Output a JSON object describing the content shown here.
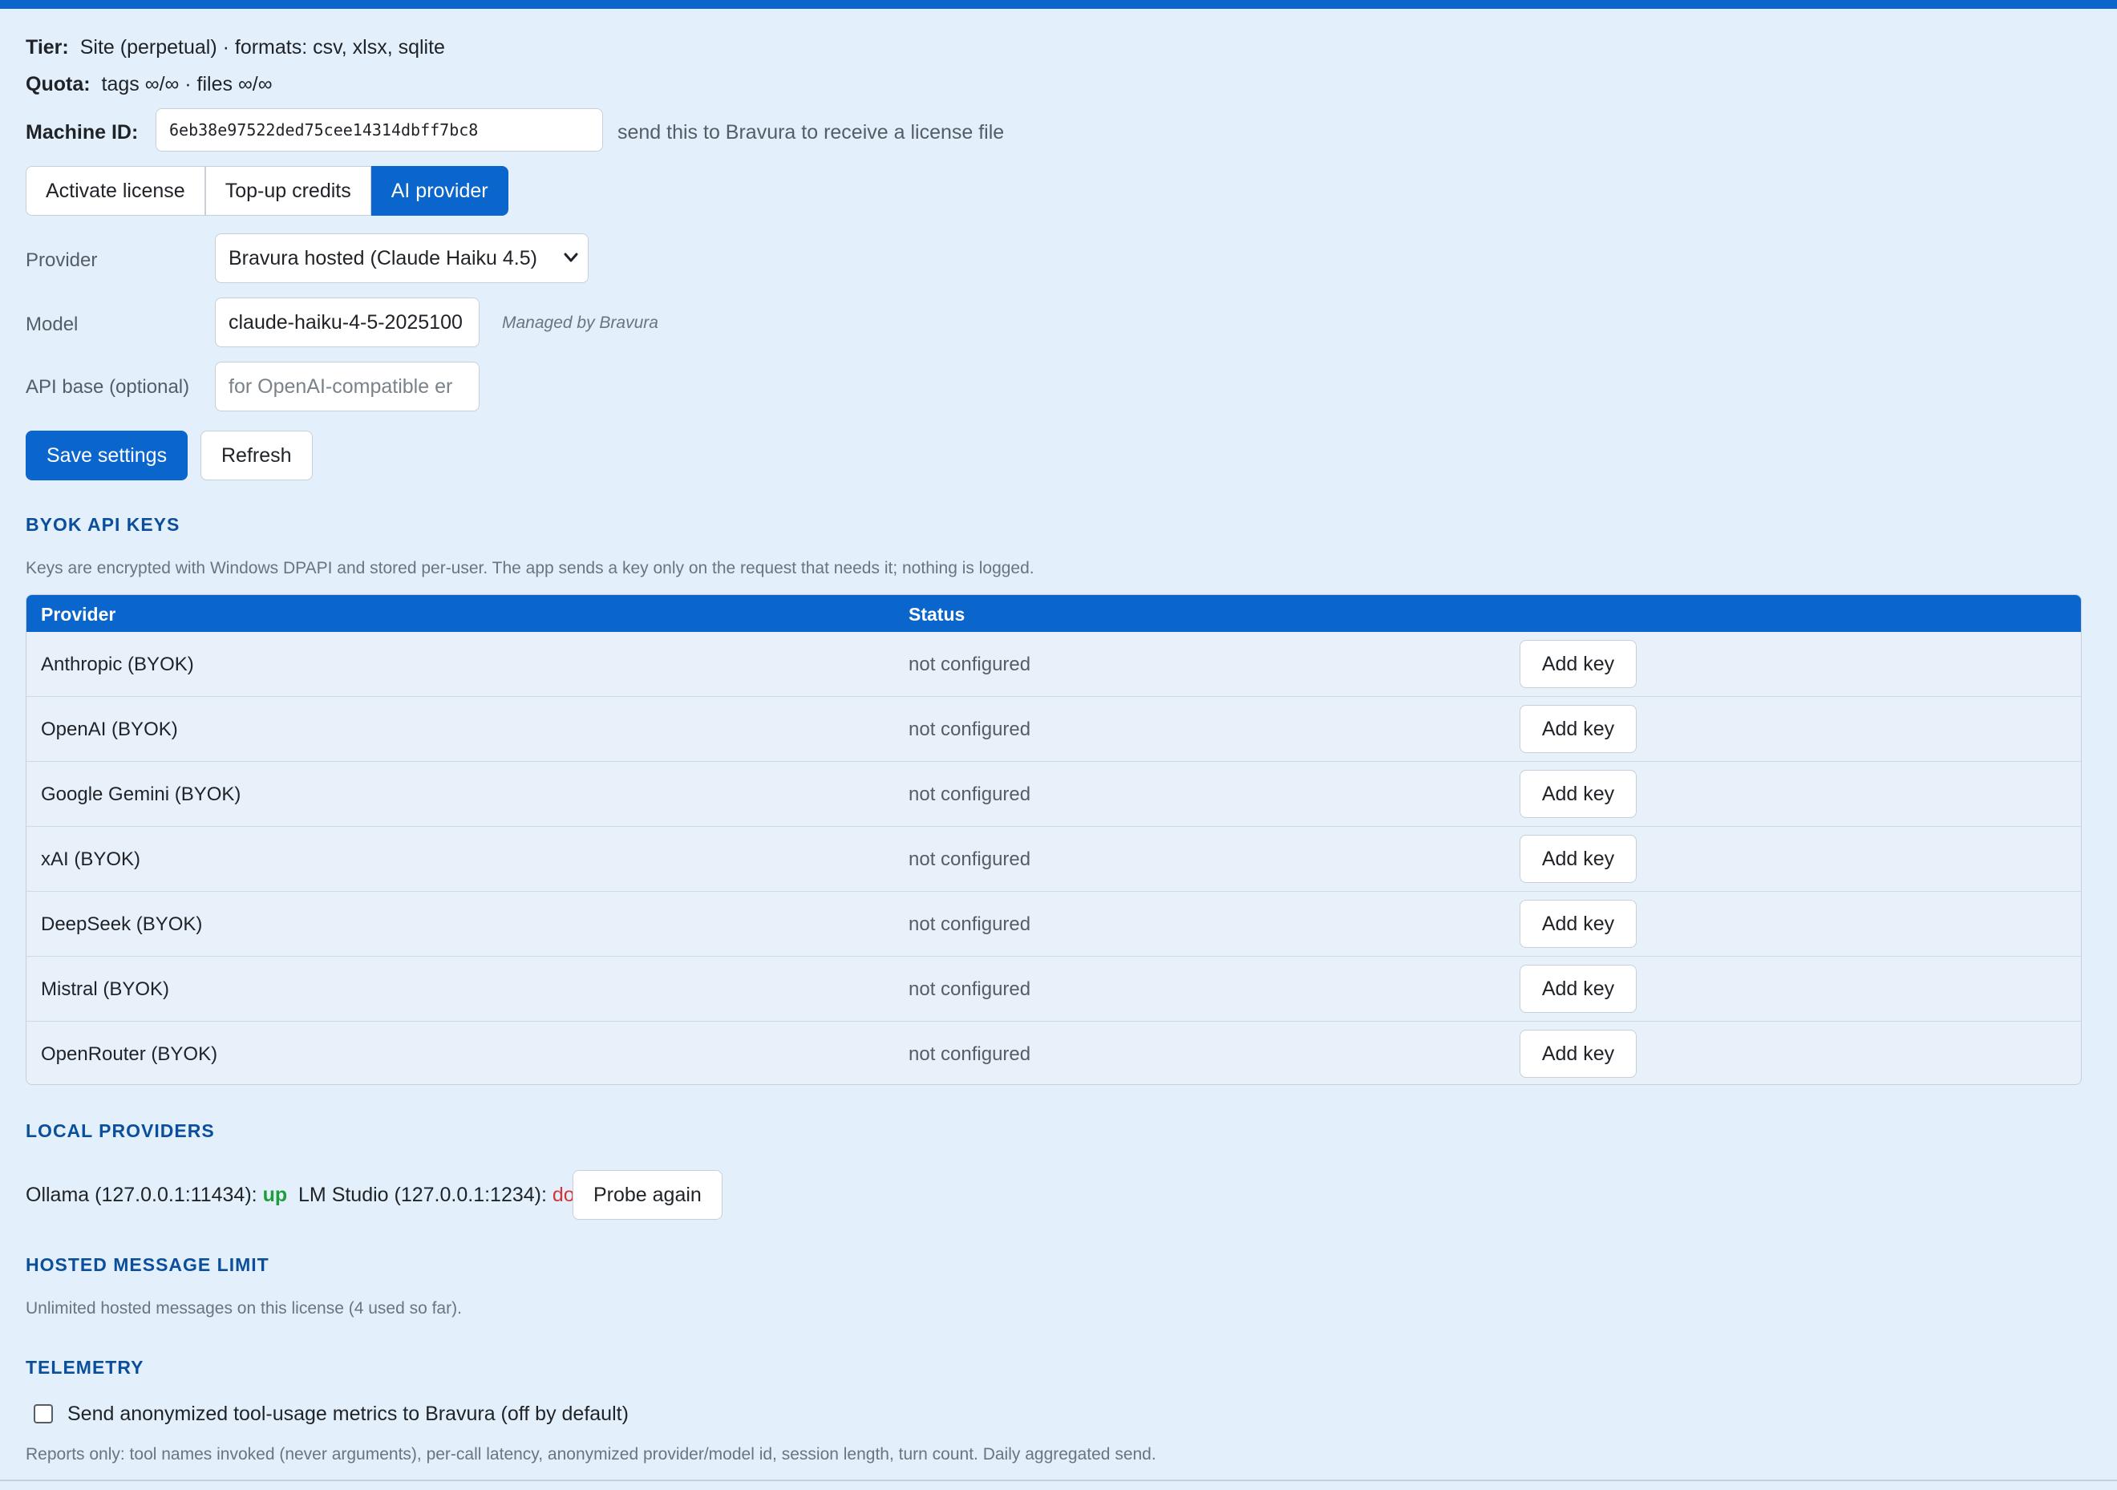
{
  "license": {
    "tier_label": "Tier:",
    "tier_value": "Site (perpetual) · formats: csv, xlsx, sqlite",
    "quota_label": "Quota:",
    "quota_value": "tags ∞/∞ · files ∞/∞",
    "machine_id_label": "Machine ID:",
    "machine_id_value": "6eb38e97522ded75cee14314dbff7bc8",
    "machine_id_hint": "send this to Bravura to receive a license file"
  },
  "tabs": [
    {
      "label": "Activate license",
      "active": false
    },
    {
      "label": "Top-up credits",
      "active": false
    },
    {
      "label": "AI provider",
      "active": true
    }
  ],
  "form": {
    "provider_label": "Provider",
    "provider_value": "Bravura hosted (Claude Haiku 4.5)",
    "model_label": "Model",
    "model_value": "claude-haiku-4-5-2025100",
    "model_note": "Managed by Bravura",
    "api_base_label": "API base (optional)",
    "api_base_placeholder": "for OpenAI-compatible er",
    "save_label": "Save settings",
    "refresh_label": "Refresh"
  },
  "byok": {
    "title": "BYOK API KEYS",
    "description": "Keys are encrypted with Windows DPAPI and stored per-user. The app sends a key only on the request that needs it; nothing is logged.",
    "columns": [
      "Provider",
      "Status"
    ],
    "rows": [
      {
        "provider": "Anthropic (BYOK)",
        "status": "not configured",
        "action": "Add key"
      },
      {
        "provider": "OpenAI (BYOK)",
        "status": "not configured",
        "action": "Add key"
      },
      {
        "provider": "Google Gemini (BYOK)",
        "status": "not configured",
        "action": "Add key"
      },
      {
        "provider": "xAI (BYOK)",
        "status": "not configured",
        "action": "Add key"
      },
      {
        "provider": "DeepSeek (BYOK)",
        "status": "not configured",
        "action": "Add key"
      },
      {
        "provider": "Mistral (BYOK)",
        "status": "not configured",
        "action": "Add key"
      },
      {
        "provider": "OpenRouter (BYOK)",
        "status": "not configured",
        "action": "Add key"
      }
    ]
  },
  "local": {
    "title": "LOCAL PROVIDERS",
    "ollama_label": "Ollama (127.0.0.1:11434):",
    "ollama_status": "up",
    "lmstudio_label": "LM Studio (127.0.0.1:1234):",
    "lmstudio_status": "down",
    "probe_label": "Probe again"
  },
  "hosted_limit": {
    "title": "HOSTED MESSAGE LIMIT",
    "text": "Unlimited hosted messages on this license (4 used so far)."
  },
  "telemetry": {
    "title": "TELEMETRY",
    "checkbox_label": "Send anonymized tool-usage metrics to Bravura (off by default)",
    "checked": false,
    "note": "Reports only: tool names invoked (never arguments), per-call latency, anonymized provider/model id, session length, turn count. Daily aggregated send."
  },
  "colors": {
    "accent": "#0a66cc",
    "background": "#e3effa",
    "status_up": "#1f9d3a",
    "status_down": "#d0353a",
    "section_title": "#0b4f9c"
  }
}
